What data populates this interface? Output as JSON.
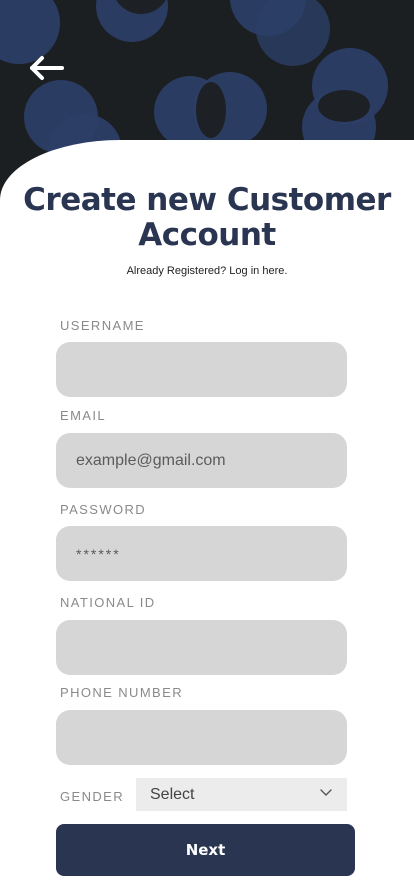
{
  "header": {
    "back_icon": "arrow-left-icon"
  },
  "title": "Create new Customer Account",
  "subtitle": "Already Registered? Log in here.",
  "form": {
    "username": {
      "label": "USERNAME",
      "placeholder": ""
    },
    "email": {
      "label": "EMAIL",
      "placeholder": "example@gmail.com"
    },
    "password": {
      "label": "PASSWORD",
      "placeholder": "******"
    },
    "national_id": {
      "label": "NATIONAL ID",
      "placeholder": ""
    },
    "phone": {
      "label": "PHONE NUMBER",
      "placeholder": ""
    },
    "gender": {
      "label": "GENDER",
      "value": "Select",
      "icon": "chevron-down-icon"
    }
  },
  "next_button": "Next",
  "colors": {
    "primary": "#2a3552",
    "accent": "#2c3e66",
    "background": "#1c1f22",
    "field": "#d6d6d6"
  }
}
